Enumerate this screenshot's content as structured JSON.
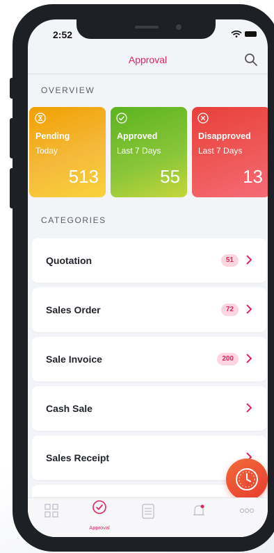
{
  "status": {
    "time": "2:52"
  },
  "header": {
    "title": "Approval"
  },
  "overview": {
    "label": "OVERVIEW",
    "cards": [
      {
        "label": "Pending",
        "sub": "Today",
        "value": "513"
      },
      {
        "label": "Approved",
        "sub": "Last 7 Days",
        "value": "55"
      },
      {
        "label": "Disapproved",
        "sub": "Last 7 Days",
        "value": "13"
      }
    ]
  },
  "categories": {
    "label": "CATEGORIES",
    "items": [
      {
        "label": "Quotation",
        "count": "51"
      },
      {
        "label": "Sales Order",
        "count": "72"
      },
      {
        "label": "Sale Invoice",
        "count": "200"
      },
      {
        "label": "Cash Sale",
        "count": ""
      },
      {
        "label": "Sales Receipt",
        "count": ""
      }
    ]
  },
  "tabbar": {
    "active_label": "Approval"
  },
  "colors": {
    "accent": "#e0245e",
    "pending": "#f5b93b",
    "approved": "#8ac63a",
    "disapproved": "#ef5a5a",
    "fab": "#ec5233"
  }
}
